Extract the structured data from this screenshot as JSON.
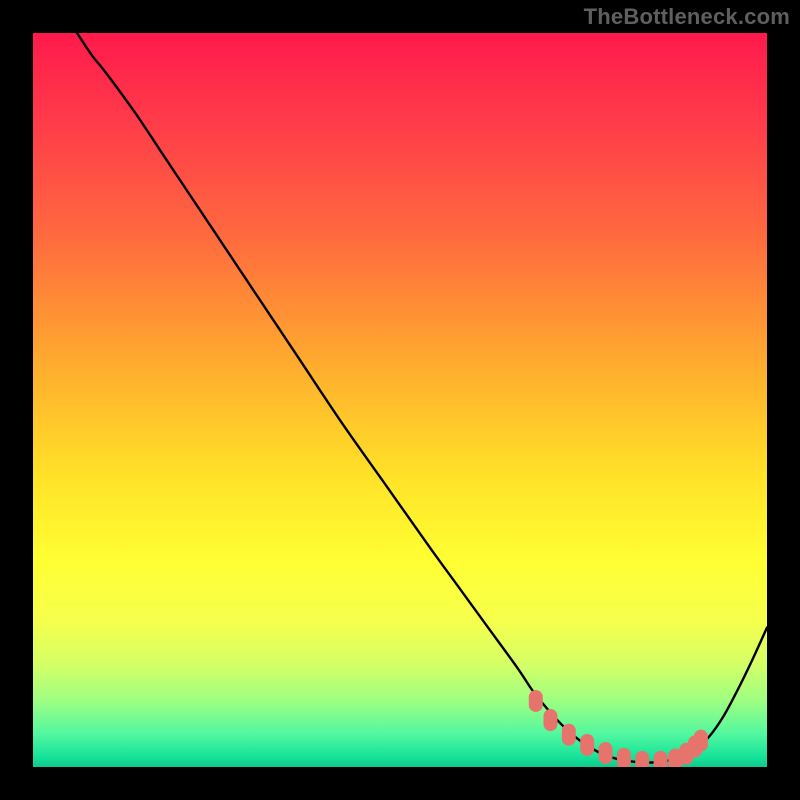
{
  "watermark": "TheBottleneck.com",
  "colors": {
    "black": "#000000",
    "curve": "#000000",
    "marker_fill": "#e6746c",
    "marker_stroke": "#d85a52",
    "gradient_stops": [
      {
        "offset": 0.0,
        "color": "#ff1a4b"
      },
      {
        "offset": 0.12,
        "color": "#ff3b4a"
      },
      {
        "offset": 0.28,
        "color": "#ff6b3e"
      },
      {
        "offset": 0.45,
        "color": "#ffab2e"
      },
      {
        "offset": 0.6,
        "color": "#ffe128"
      },
      {
        "offset": 0.72,
        "color": "#ffff33"
      },
      {
        "offset": 0.8,
        "color": "#f6ff4c"
      },
      {
        "offset": 0.86,
        "color": "#d4ff66"
      },
      {
        "offset": 0.91,
        "color": "#9dff82"
      },
      {
        "offset": 0.955,
        "color": "#52f7a0"
      },
      {
        "offset": 0.985,
        "color": "#18e49a"
      },
      {
        "offset": 1.0,
        "color": "#0fc98f"
      }
    ]
  },
  "chart_data": {
    "type": "line",
    "title": "",
    "xlabel": "",
    "ylabel": "",
    "xlim": [
      0,
      100
    ],
    "ylim": [
      0,
      100
    ],
    "grid": false,
    "series": [
      {
        "name": "bottleneck-curve",
        "x": [
          6,
          8,
          10,
          14,
          18,
          24,
          30,
          36,
          42,
          48,
          54,
          58,
          62,
          66,
          68,
          70,
          72,
          74,
          76,
          78,
          80,
          82,
          84,
          86,
          88,
          90,
          92,
          94,
          96,
          98,
          100
        ],
        "y": [
          100,
          97,
          94.5,
          89,
          83,
          74,
          65,
          56,
          47,
          38.5,
          30,
          24.5,
          19,
          13.5,
          10.5,
          8,
          5.8,
          4.0,
          2.6,
          1.6,
          1.0,
          0.7,
          0.6,
          0.8,
          1.2,
          2.2,
          4.0,
          6.8,
          10.5,
          14.6,
          19
        ]
      }
    ],
    "markers": {
      "name": "optimal-zone",
      "x": [
        68.5,
        70.5,
        73,
        75.5,
        78,
        80.5,
        83,
        85.5,
        87.5,
        89.0,
        90.2,
        91.0
      ],
      "y": [
        9.0,
        6.4,
        4.4,
        3.0,
        1.9,
        1.1,
        0.7,
        0.7,
        1.0,
        1.8,
        2.8,
        3.6
      ]
    }
  }
}
